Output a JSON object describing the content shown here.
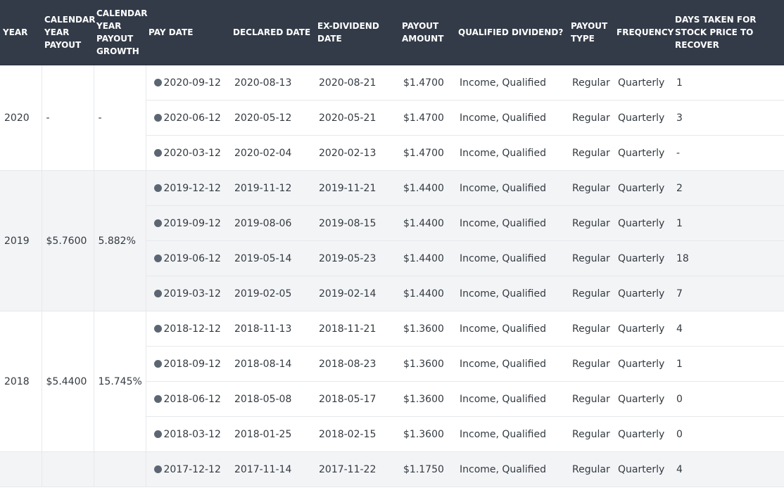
{
  "headers": {
    "year": "YEAR",
    "cal_payout": "CALENDAR YEAR PAYOUT",
    "cal_growth": "CALENDAR YEAR PAYOUT GROWTH",
    "pay_date": "PAY DATE",
    "declared": "DECLARED DATE",
    "exdiv": "EX-DIVIDEND DATE",
    "amount": "PAYOUT AMOUNT",
    "qualified": "QUALIFIED DIVIDEND?",
    "type": "PAYOUT TYPE",
    "frequency": "FREQUENCY",
    "days": "DAYS TAKEN FOR STOCK PRICE TO RECOVER"
  },
  "groups": [
    {
      "year": "2020",
      "payout": "-",
      "growth": "-",
      "shade": false,
      "rows": [
        {
          "pay": "2020-09-12",
          "declared": "2020-08-13",
          "exdiv": "2020-08-21",
          "amount": "$1.4700",
          "qualified": "Income, Qualified",
          "type": "Regular",
          "frequency": "Quarterly",
          "days": "1"
        },
        {
          "pay": "2020-06-12",
          "declared": "2020-05-12",
          "exdiv": "2020-05-21",
          "amount": "$1.4700",
          "qualified": "Income, Qualified",
          "type": "Regular",
          "frequency": "Quarterly",
          "days": "3"
        },
        {
          "pay": "2020-03-12",
          "declared": "2020-02-04",
          "exdiv": "2020-02-13",
          "amount": "$1.4700",
          "qualified": "Income, Qualified",
          "type": "Regular",
          "frequency": "Quarterly",
          "days": "-"
        }
      ]
    },
    {
      "year": "2019",
      "payout": "$5.7600",
      "growth": "5.882%",
      "shade": true,
      "rows": [
        {
          "pay": "2019-12-12",
          "declared": "2019-11-12",
          "exdiv": "2019-11-21",
          "amount": "$1.4400",
          "qualified": "Income, Qualified",
          "type": "Regular",
          "frequency": "Quarterly",
          "days": "2"
        },
        {
          "pay": "2019-09-12",
          "declared": "2019-08-06",
          "exdiv": "2019-08-15",
          "amount": "$1.4400",
          "qualified": "Income, Qualified",
          "type": "Regular",
          "frequency": "Quarterly",
          "days": "1"
        },
        {
          "pay": "2019-06-12",
          "declared": "2019-05-14",
          "exdiv": "2019-05-23",
          "amount": "$1.4400",
          "qualified": "Income, Qualified",
          "type": "Regular",
          "frequency": "Quarterly",
          "days": "18"
        },
        {
          "pay": "2019-03-12",
          "declared": "2019-02-05",
          "exdiv": "2019-02-14",
          "amount": "$1.4400",
          "qualified": "Income, Qualified",
          "type": "Regular",
          "frequency": "Quarterly",
          "days": "7"
        }
      ]
    },
    {
      "year": "2018",
      "payout": "$5.4400",
      "growth": "15.745%",
      "shade": false,
      "rows": [
        {
          "pay": "2018-12-12",
          "declared": "2018-11-13",
          "exdiv": "2018-11-21",
          "amount": "$1.3600",
          "qualified": "Income, Qualified",
          "type": "Regular",
          "frequency": "Quarterly",
          "days": "4"
        },
        {
          "pay": "2018-09-12",
          "declared": "2018-08-14",
          "exdiv": "2018-08-23",
          "amount": "$1.3600",
          "qualified": "Income, Qualified",
          "type": "Regular",
          "frequency": "Quarterly",
          "days": "1"
        },
        {
          "pay": "2018-06-12",
          "declared": "2018-05-08",
          "exdiv": "2018-05-17",
          "amount": "$1.3600",
          "qualified": "Income, Qualified",
          "type": "Regular",
          "frequency": "Quarterly",
          "days": "0"
        },
        {
          "pay": "2018-03-12",
          "declared": "2018-01-25",
          "exdiv": "2018-02-15",
          "amount": "$1.3600",
          "qualified": "Income, Qualified",
          "type": "Regular",
          "frequency": "Quarterly",
          "days": "0"
        }
      ]
    },
    {
      "year": "",
      "payout": "",
      "growth": "",
      "shade": true,
      "rows": [
        {
          "pay": "2017-12-12",
          "declared": "2017-11-14",
          "exdiv": "2017-11-22",
          "amount": "$1.1750",
          "qualified": "Income, Qualified",
          "type": "Regular",
          "frequency": "Quarterly",
          "days": "4"
        }
      ]
    }
  ]
}
